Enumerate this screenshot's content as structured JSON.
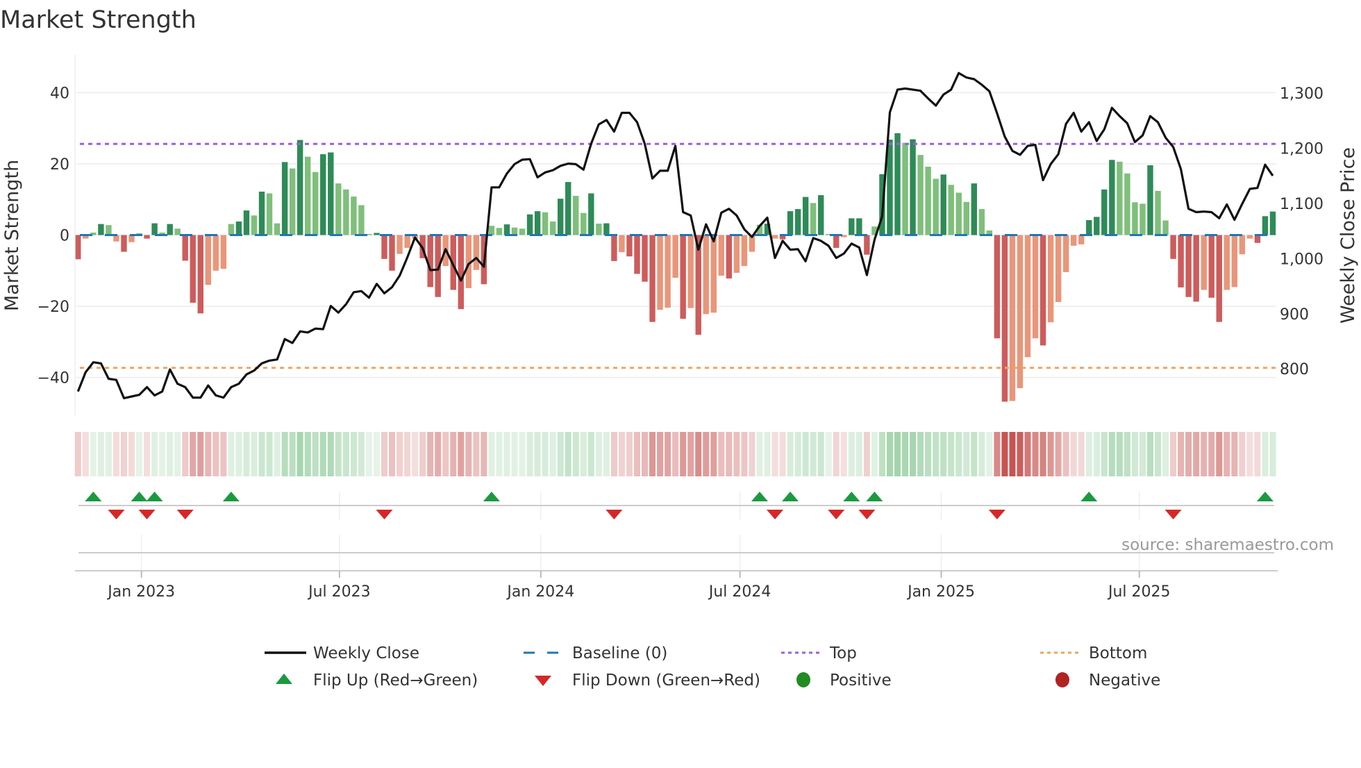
{
  "title": "Market Strength",
  "source": "source: sharemaestro.com",
  "colors": {
    "pos_up": "#2e8b57",
    "pos_down": "#7fbf7b",
    "neg_up": "#cd5c5c",
    "neg_down": "#e9967a",
    "baseline": "#1f77b4",
    "top": "#9b5fe0",
    "bottom": "#f0a35e",
    "flip_up": "#1a9a3f",
    "flip_down": "#d62728",
    "positive": "#228b22",
    "negative": "#b22222",
    "line": "#111111"
  },
  "legend": [
    {
      "label": "Weekly Close",
      "symbol": "line"
    },
    {
      "label": "Baseline (0)",
      "symbol": "dash"
    },
    {
      "label": "Top",
      "symbol": "dot-purple"
    },
    {
      "label": "Bottom",
      "symbol": "dot-orange"
    },
    {
      "label": "Flip Up (Red→Green)",
      "symbol": "tri-up"
    },
    {
      "label": "Flip Down (Green→Red)",
      "symbol": "tri-down"
    },
    {
      "label": "Positive",
      "symbol": "circle-green"
    },
    {
      "label": "Negative",
      "symbol": "circle-red"
    }
  ],
  "chart_data": {
    "type": "bar",
    "title": "Market Strength",
    "ylabel": "Market Strength",
    "y2label": "Weekly Close Price",
    "ylim": [
      -50.6,
      50.6
    ],
    "y2lim": [
      716,
      1369
    ],
    "yticks": [
      40,
      20,
      0,
      -20,
      -40
    ],
    "yticklabels": [
      "40",
      "20",
      "0",
      "−20",
      "−40"
    ],
    "y2ticks": [
      1300,
      1200,
      1100,
      1000,
      900,
      800
    ],
    "y2ticklabels": [
      "1,300",
      "1,200",
      "1,100",
      "1,000",
      "900",
      "800"
    ],
    "start_date": "2022-11-04",
    "frequency": "weekly",
    "xticks": [
      {
        "date": "2023-01-01",
        "label": "Jan 2023"
      },
      {
        "date": "2023-07-01",
        "label": "Jul 2023"
      },
      {
        "date": "2024-01-01",
        "label": "Jan 2024"
      },
      {
        "date": "2024-07-01",
        "label": "Jul 2024"
      },
      {
        "date": "2025-01-01",
        "label": "Jan 2025"
      },
      {
        "date": "2025-07-01",
        "label": "Jul 2025"
      }
    ],
    "top_level": 25.6,
    "bottom_level": -37.3,
    "baseline": 0,
    "strength": [
      -6.8,
      -1,
      0.7,
      3.1,
      2.8,
      -1.8,
      -4.7,
      -2,
      0.5,
      -1,
      3.3,
      0.7,
      3.1,
      1.8,
      -7.2,
      -19,
      -22,
      -14,
      -10,
      -9.5,
      3.1,
      3.8,
      6.9,
      5.5,
      12.2,
      11.7,
      3.3,
      20.5,
      18.7,
      26.7,
      22,
      17.7,
      22.7,
      23.2,
      14.5,
      12.8,
      10.8,
      8.4,
      0.3,
      0.6,
      -6.7,
      -10,
      -5.3,
      -3.6,
      -1,
      -6.5,
      -14.6,
      -17.4,
      -8.7,
      -15.4,
      -20.8,
      -14.9,
      -9.8,
      -13.8,
      2.6,
      2,
      3,
      2.1,
      1.8,
      5.8,
      6.7,
      6.4,
      3.8,
      10.2,
      14.9,
      11,
      6.2,
      11.7,
      3.2,
      3.3,
      -7.3,
      -4.8,
      -6,
      -10.9,
      -13.1,
      -24.4,
      -21,
      -20.4,
      -12,
      -23.5,
      -20.5,
      -28,
      -22.2,
      -21.8,
      -11.4,
      -12.2,
      -10.6,
      -8.7,
      -4.7,
      2.9,
      3.2,
      -1,
      -1.2,
      6.7,
      7.3,
      10.7,
      9,
      11.2,
      0.3,
      -3.6,
      -0.6,
      4.7,
      4.7,
      -5.5,
      2.4,
      17.1,
      26.8,
      28.6,
      25.9,
      26.9,
      22.5,
      19.2,
      15.8,
      17,
      14.1,
      11.9,
      9.3,
      14.5,
      7.3,
      1.3,
      -29,
      -46.8,
      -46.6,
      -43,
      -34.3,
      -29,
      -31,
      -24.5,
      -18.8,
      -10.4,
      -3,
      -2.6,
      4.2,
      5.1,
      12.8,
      21.1,
      20.6,
      17.3,
      9.2,
      8.8,
      19.6,
      12.4,
      4.1,
      -6.7,
      -14.7,
      -17.4,
      -18.7,
      -15.4,
      -17.6,
      -24.4,
      -15.4,
      -14.6,
      -5.4,
      -1,
      -2.2,
      5.3,
      6.6
    ],
    "weekly_close": [
      759,
      794,
      812,
      810,
      782,
      780,
      747,
      750,
      753,
      767,
      752,
      759,
      799,
      773,
      767,
      748,
      748,
      770,
      752,
      748,
      767,
      773,
      790,
      797,
      810,
      815,
      817,
      854,
      847,
      868,
      866,
      873,
      872,
      914,
      902,
      917,
      939,
      941,
      929,
      954,
      937,
      948,
      969,
      1002,
      1038,
      1019,
      979,
      980,
      1017,
      988,
      960,
      990,
      1001,
      985,
      1129,
      1129,
      1154,
      1171,
      1179,
      1180,
      1147,
      1156,
      1160,
      1168,
      1172,
      1171,
      1161,
      1208,
      1243,
      1251,
      1230,
      1264,
      1264,
      1247,
      1208,
      1145,
      1159,
      1159,
      1204,
      1084,
      1078,
      1016,
      1062,
      1031,
      1083,
      1090,
      1078,
      1053,
      1039,
      1059,
      1074,
      1001,
      1032,
      1016,
      1017,
      995,
      1037,
      1032,
      1023,
      1001,
      1009,
      1027,
      1020,
      970,
      1034,
      1076,
      1265,
      1306,
      1308,
      1306,
      1304,
      1290,
      1277,
      1297,
      1306,
      1336,
      1328,
      1325,
      1315,
      1303,
      1263,
      1221,
      1195,
      1188,
      1204,
      1206,
      1142,
      1171,
      1189,
      1244,
      1264,
      1230,
      1247,
      1213,
      1234,
      1273,
      1258,
      1245,
      1211,
      1223,
      1258,
      1247,
      1219,
      1202,
      1162,
      1090,
      1084,
      1085,
      1084,
      1073,
      1098,
      1070,
      1099,
      1126,
      1128,
      1170,
      1150
    ],
    "flip_up_index": [
      2,
      8,
      10,
      20,
      54,
      89,
      93,
      101,
      104,
      132,
      155
    ],
    "flip_down_index": [
      5,
      9,
      14,
      40,
      70,
      91,
      99,
      103,
      120,
      143
    ]
  }
}
